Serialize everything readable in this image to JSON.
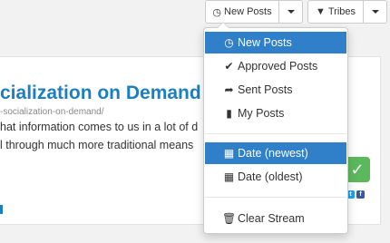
{
  "toolbar": {
    "new_posts_label": "New Posts",
    "tribes_label": "Tribes"
  },
  "card": {
    "title": "cialization on Demand",
    "url": "-socialization-on-demand/",
    "text_line1": "hat information comes to us in a lot of d",
    "text_line2": "l through much more traditional means"
  },
  "dropdown": {
    "items": [
      {
        "label": "New Posts",
        "icon": "clock-icon",
        "active": true
      },
      {
        "label": "Approved Posts",
        "icon": "check-icon",
        "active": false
      },
      {
        "label": "Sent Posts",
        "icon": "share-arrow-icon",
        "active": false
      },
      {
        "label": "My Posts",
        "icon": "book-icon",
        "active": false
      },
      {
        "label": "Date (newest)",
        "icon": "calendar-icon",
        "active": true
      },
      {
        "label": "Date (oldest)",
        "icon": "calendar-icon",
        "active": false
      },
      {
        "label": "Clear Stream",
        "icon": "trash-icon",
        "active": false
      }
    ]
  },
  "colors": {
    "accent": "#2f80c9",
    "title": "#1c7fbf",
    "approve": "#5cb85c"
  }
}
